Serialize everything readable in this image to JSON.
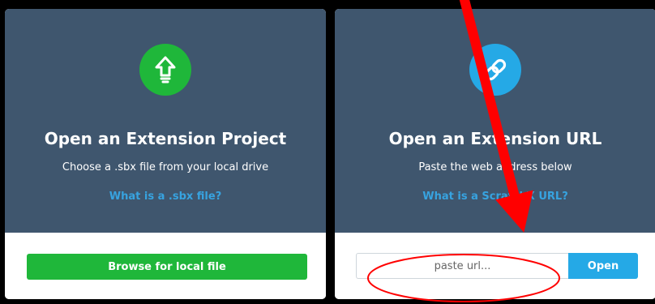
{
  "project_card": {
    "icon": "upload-arrow-icon",
    "title": "Open an Extension Project",
    "description": "Choose a .sbx file from your local drive",
    "help_link": "What is a .sbx file?",
    "button_label": "Browse for local file"
  },
  "url_card": {
    "icon": "link-icon",
    "title": "Open an Extension URL",
    "description": "Paste the web address below",
    "help_link": "What is a ScratchX URL?",
    "input_placeholder": "paste url...",
    "input_value": "",
    "button_label": "Open"
  },
  "annotation": {
    "color": "#ff0000",
    "marks": [
      "arrow",
      "ellipse"
    ]
  },
  "colors": {
    "card_header": "#3f566e",
    "green": "#1fb73a",
    "blue": "#25a9e6",
    "link": "#37a3e0"
  }
}
